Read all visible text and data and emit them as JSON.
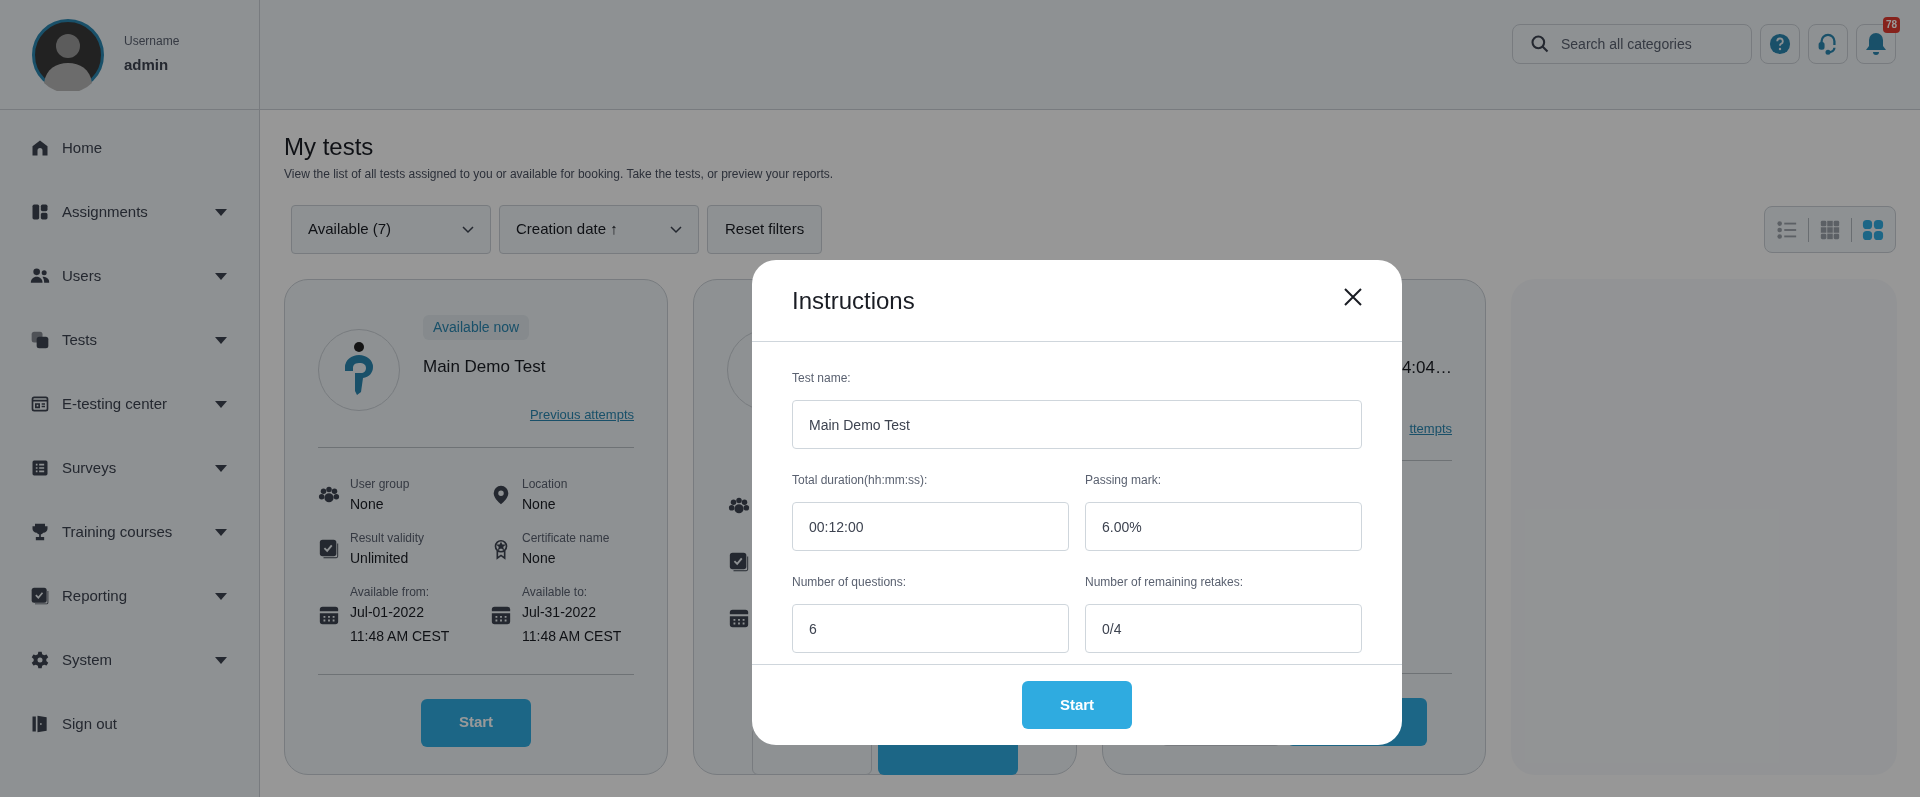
{
  "user": {
    "caption": "Username",
    "name": "admin"
  },
  "sidebar": {
    "items": [
      {
        "kind": "home",
        "label": "Home",
        "expandable": false
      },
      {
        "kind": "assignments",
        "label": "Assignments",
        "expandable": true
      },
      {
        "kind": "users",
        "label": "Users",
        "expandable": true
      },
      {
        "kind": "tests",
        "label": "Tests",
        "expandable": true
      },
      {
        "kind": "center",
        "label": "E-testing center",
        "expandable": true
      },
      {
        "kind": "surveys",
        "label": "Surveys",
        "expandable": true
      },
      {
        "kind": "training",
        "label": "Training courses",
        "expandable": true
      },
      {
        "kind": "reporting",
        "label": "Reporting",
        "expandable": true
      },
      {
        "kind": "system",
        "label": "System",
        "expandable": true
      },
      {
        "kind": "signout",
        "label": "Sign out",
        "expandable": false
      }
    ]
  },
  "header": {
    "search": {
      "placeholder": "Search all categories"
    },
    "notifications": "78"
  },
  "page": {
    "title": "My tests",
    "subtitle": "View the list of all tests assigned to you or available for booking. Take the tests, or preview your reports."
  },
  "filters": [
    {
      "kind": "dropdown",
      "label": "Available (7)"
    },
    {
      "kind": "dropdown",
      "label": "Creation date ↑"
    },
    {
      "kind": "button",
      "label": "Reset filters"
    }
  ],
  "view_modes": [
    {
      "kind": "list",
      "selected": false
    },
    {
      "kind": "grid",
      "selected": false
    },
    {
      "kind": "cards",
      "selected": true
    }
  ],
  "card": {
    "badge": "Available now",
    "title": "Main Demo Test",
    "link": "Previous attempts",
    "button": "Start",
    "fields": [
      {
        "kind": "group",
        "label": "User group",
        "value": "None"
      },
      {
        "kind": "location",
        "label": "Location",
        "value": "None"
      },
      {
        "kind": "validity",
        "label": "Result validity",
        "value": "Unlimited"
      },
      {
        "kind": "certificate",
        "label": "Certificate name",
        "value": "None"
      },
      {
        "kind": "date",
        "label": "Available from:",
        "value": "Jul-01-2022",
        "time": "11:48 AM CEST"
      },
      {
        "kind": "date",
        "label": "Available to:",
        "value": "Jul-31-2022",
        "time": "11:48 AM CEST"
      }
    ]
  },
  "partial_card": {
    "title": "4:04…",
    "link": "ttempts"
  },
  "modal": {
    "title": "Instructions",
    "button": "Start",
    "fields": [
      {
        "label": "Test name:",
        "value": "Main Demo Test",
        "wide": true
      },
      {
        "label": "Total duration(hh:mm:ss):",
        "value": "00:12:00",
        "wide": false
      },
      {
        "label": "Passing mark:",
        "value": "6.00%",
        "wide": false
      },
      {
        "label": "Number of questions:",
        "value": "6",
        "wide": false
      },
      {
        "label": "Number of remaining retakes:",
        "value": "0/4",
        "wide": false
      }
    ]
  }
}
